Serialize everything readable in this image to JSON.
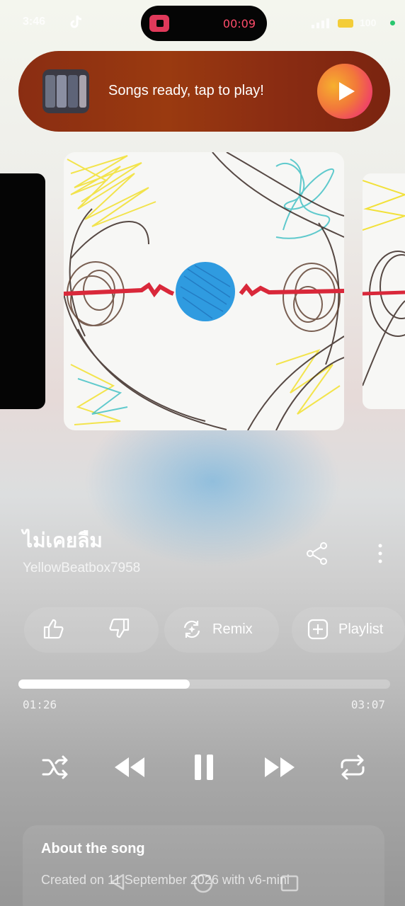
{
  "status_bar": {
    "time": "3:46",
    "extra": "🅿",
    "recording_time": "00:09",
    "battery": "100"
  },
  "banner": {
    "text": "Songs ready, tap to play!",
    "thumbnail_icon": "album-thumbnail",
    "play_icon": "play-icon"
  },
  "song": {
    "title": "ไม่เคยลืม",
    "artist": "YellowBeatbox7958"
  },
  "actions": {
    "like_icon": "thumbs-up-icon",
    "dislike_icon": "thumbs-down-icon",
    "remix_label": "Remix",
    "playlist_label": "Playlist"
  },
  "progress": {
    "current": "01:26",
    "duration": "03:07",
    "fraction": 0.46
  },
  "controls": [
    "shuffle-icon",
    "previous-icon",
    "pause-icon",
    "next-icon",
    "repeat-icon"
  ],
  "about": {
    "title": "About the song",
    "body": "Created on 11 September 2026 with v6-mini"
  },
  "colors": {
    "banner": "#8a2d12",
    "play_gradient_start": "#f6b02e",
    "play_gradient_end": "#e42d76",
    "recording": "#ff4c6a"
  }
}
